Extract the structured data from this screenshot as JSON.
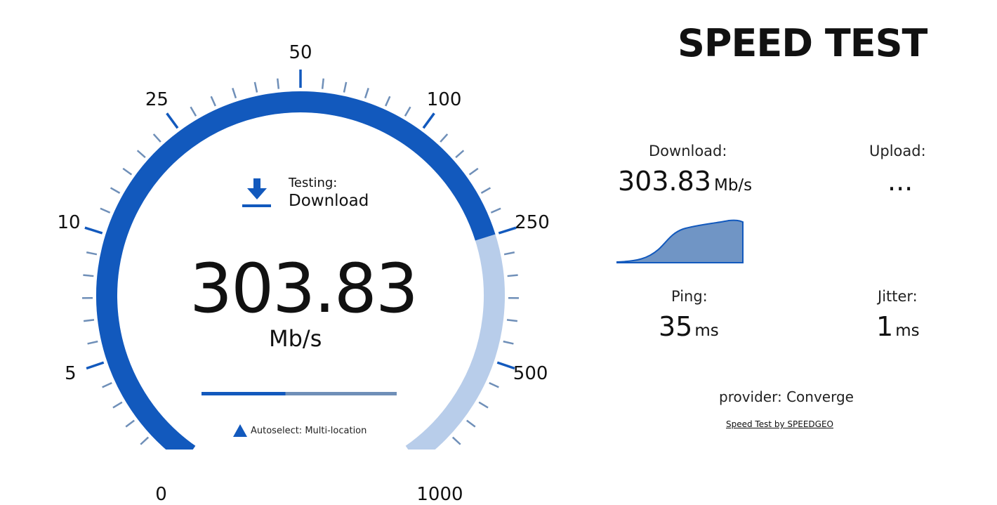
{
  "title": "SPEED TEST",
  "accent_color": "#1259bd",
  "accent_light_color": "#b8cdea",
  "gauge": {
    "ticks": [
      "0",
      "5",
      "10",
      "25",
      "50",
      "100",
      "250",
      "500",
      "1000"
    ],
    "level_fraction": 0.75,
    "testing_label": "Testing:",
    "testing_value": "Download",
    "value": "303.83",
    "unit": "Mb/s",
    "progress_fraction": 0.43,
    "server_label": "Autoselect: Multi-location",
    "testing_icon": "download-arrow-icon",
    "server_icon": "triangle-icon"
  },
  "stats": {
    "download": {
      "label": "Download:",
      "value": "303.83",
      "unit": "Mb/s"
    },
    "upload": {
      "label": "Upload:",
      "value": "..."
    },
    "ping": {
      "label": "Ping:",
      "value": "35",
      "unit": "ms"
    },
    "jitter": {
      "label": "Jitter:",
      "value": "1",
      "unit": "ms"
    }
  },
  "provider": {
    "label": "provider:",
    "name": "Converge"
  },
  "credit": "Speed Test by SPEEDGEO"
}
